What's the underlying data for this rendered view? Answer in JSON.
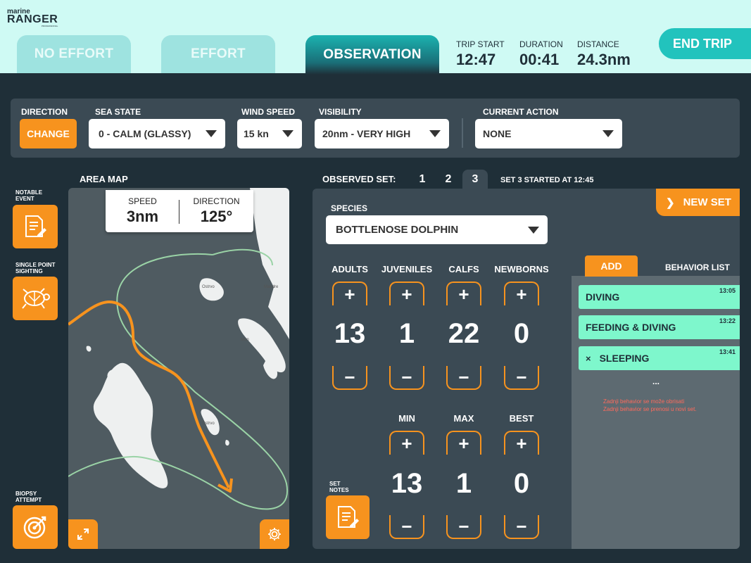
{
  "logo": {
    "line1": "marine",
    "line2": "RANGER",
    "line3": "PROFESSIONAL"
  },
  "tabs": [
    {
      "label": "NO EFFORT",
      "active": false
    },
    {
      "label": "EFFORT",
      "active": false
    },
    {
      "label": "OBSERVATION",
      "active": true
    }
  ],
  "trip": {
    "start_label": "TRIP START",
    "start_value": "12:47",
    "duration_label": "DURATION",
    "duration_value": "00:41",
    "distance_label": "DISTANCE",
    "distance_value": "24.3nm",
    "end_label": "END TRIP"
  },
  "conditions": {
    "direction_label": "DIRECTION",
    "change_label": "CHANGE",
    "sea_state_label": "SEA STATE",
    "sea_state_value": "0 - CALM (GLASSY)",
    "wind_speed_label": "WIND SPEED",
    "wind_speed_value": "15 kn",
    "visibility_label": "VISIBILITY",
    "visibility_value": "20nm - VERY HIGH",
    "current_action_label": "CURRENT ACTION",
    "current_action_value": "NONE"
  },
  "side": {
    "notable_event": "NOTABLE EVENT",
    "single_point": "SINGLE POINT SIGHTING",
    "biopsy": "BIOPSY ATTEMPT"
  },
  "map": {
    "title": "AREA MAP",
    "speed_label": "SPEED",
    "speed_value": "3nm",
    "direction_label": "DIRECTION",
    "direction_value": "125°",
    "place_labels": [
      "Ostrvo",
      "Mandre",
      "Mun",
      "Ostrvo"
    ]
  },
  "observed": {
    "title": "OBSERVED SET:",
    "sets": [
      "1",
      "2",
      "3"
    ],
    "active_set": "3",
    "started_text": "SET 3 STARTED AT 12:45",
    "new_set_label": "NEW SET",
    "species_label": "SPECIES",
    "species_value": "BOTTLENOSE DOLPHIN",
    "counts": [
      {
        "label": "ADULTS",
        "value": "13"
      },
      {
        "label": "JUVENILES",
        "value": "1"
      },
      {
        "label": "CALFS",
        "value": "22"
      },
      {
        "label": "NEWBORNS",
        "value": "0"
      }
    ],
    "group": [
      {
        "label": "MIN",
        "value": "13"
      },
      {
        "label": "MAX",
        "value": "1"
      },
      {
        "label": "BEST",
        "value": "0"
      }
    ],
    "plus": "+",
    "minus": "−",
    "set_notes_label": "SET NOTES"
  },
  "behaviors": {
    "add_label": "ADD",
    "list_label": "BEHAVIOR LIST",
    "items": [
      {
        "name": "DIVING",
        "time": "13:05",
        "removable": false
      },
      {
        "name": "FEEDING & DIVING",
        "time": "13:22",
        "removable": false
      },
      {
        "name": "SLEEPING",
        "time": "13:41",
        "removable": true
      }
    ],
    "remove_symbol": "×",
    "ellipsis": "...",
    "notes": [
      "Zadnji behavior se može obrisati",
      "Zadnji behavior se prenosi u novi set."
    ]
  },
  "colors": {
    "accent": "#f7931e",
    "teal": "#22c3bd",
    "background": "#1f2f38",
    "panel": "#3b4a54",
    "behavior": "#7ef7cc"
  }
}
